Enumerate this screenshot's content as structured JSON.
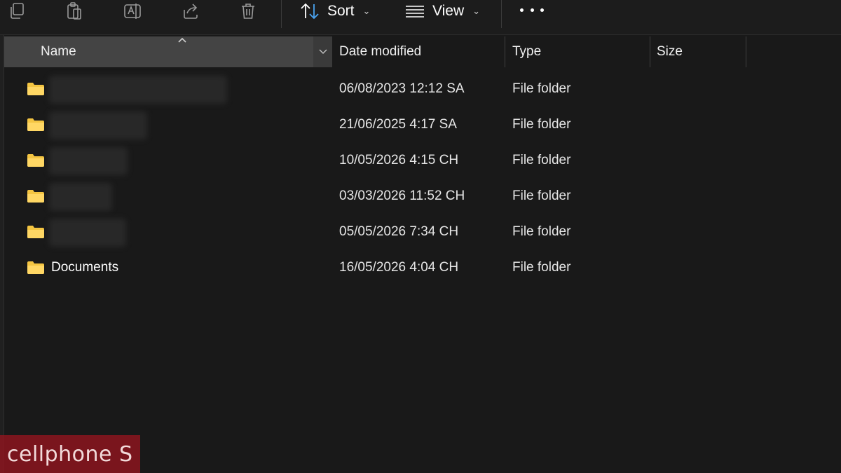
{
  "toolbar": {
    "icons": [
      "copy-icon",
      "paste-icon",
      "rename-icon",
      "share-icon",
      "delete-icon"
    ],
    "sort_label": "Sort",
    "view_label": "View",
    "more_icon": "more-icon"
  },
  "columns": {
    "name": "Name",
    "date": "Date modified",
    "type": "Type",
    "size": "Size"
  },
  "rows": [
    {
      "name": "",
      "blurred": true,
      "date": "06/08/2023 12:12 SA",
      "type": "File folder"
    },
    {
      "name": "",
      "blurred": true,
      "date": "21/06/2025 4:17 SA",
      "type": "File folder"
    },
    {
      "name": "",
      "blurred": true,
      "date": "10/05/2026 4:15 CH",
      "type": "File folder"
    },
    {
      "name": "",
      "blurred": true,
      "date": "03/03/2026 11:52 CH",
      "type": "File folder"
    },
    {
      "name": "",
      "blurred": true,
      "date": "05/05/2026 7:34 CH",
      "type": "File folder"
    },
    {
      "name": "Documents",
      "blurred": false,
      "date": "16/05/2026 4:04 CH",
      "type": "File folder"
    }
  ],
  "watermark": {
    "text": "cellphone S"
  },
  "colors": {
    "background": "#191919",
    "header_selected": "#444444",
    "accent_blue": "#4aa3f0",
    "folder": "#f4c542",
    "watermark": "#a0141e"
  }
}
